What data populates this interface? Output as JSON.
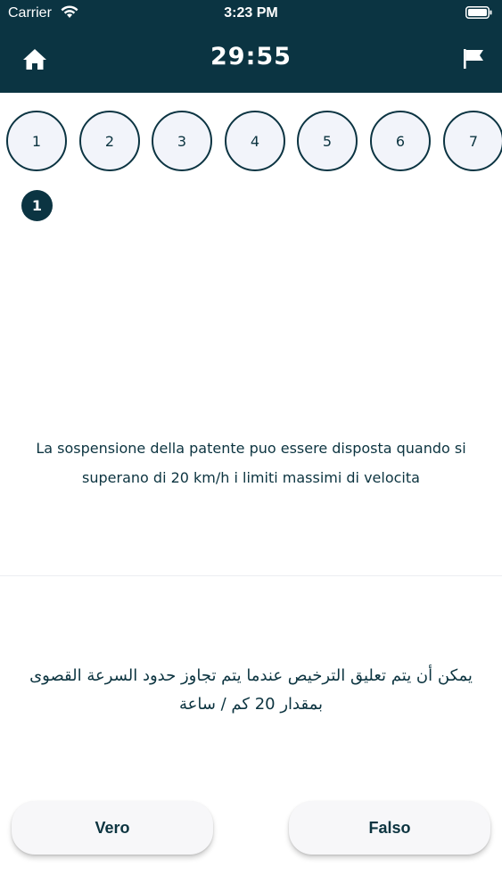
{
  "status_bar": {
    "carrier": "Carrier",
    "time": "3:23 PM"
  },
  "header": {
    "timer": "29:55",
    "home_icon": "home-icon",
    "flag_icon": "flag-icon"
  },
  "question_nav": {
    "numbers": [
      "1",
      "2",
      "3",
      "4",
      "5",
      "6",
      "7"
    ],
    "current": "1"
  },
  "question": {
    "italian": "La sospensione della patente puo essere disposta quando si superano di 20 km/h i limiti massimi di velocita",
    "arabic": "يمكن أن يتم تعليق الترخيص عندما يتم تجاوز حدود السرعة القصوى بمقدار 20 كم / ساعة"
  },
  "answers": {
    "true_label": "Vero",
    "false_label": "Falso"
  },
  "colors": {
    "header_bg": "#0b3442",
    "text": "#0c3440",
    "circle_bg": "#f2f4fa"
  }
}
